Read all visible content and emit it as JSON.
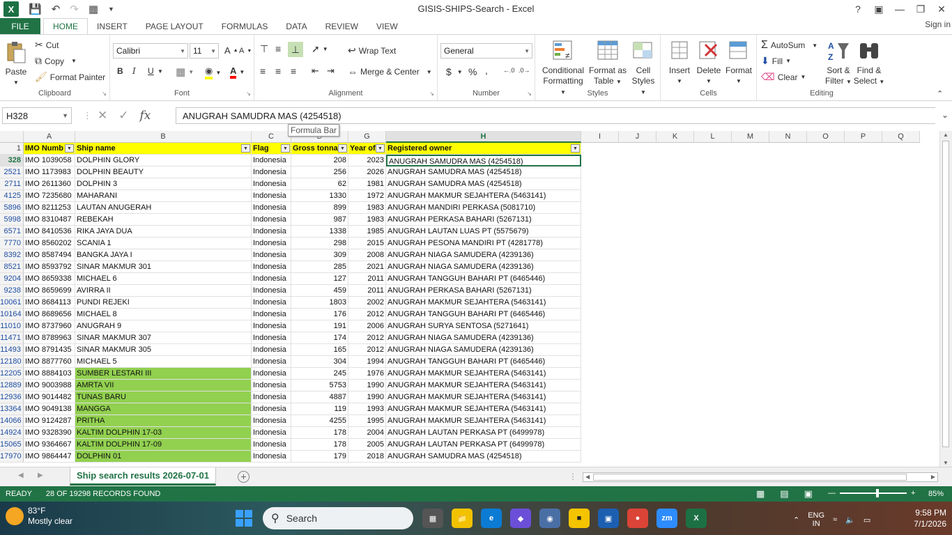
{
  "window": {
    "title": "GISIS-SHIPS-Search - Excel",
    "help": "?",
    "signin": "Sign in"
  },
  "tabs": [
    "FILE",
    "HOME",
    "INSERT",
    "PAGE LAYOUT",
    "FORMULAS",
    "DATA",
    "REVIEW",
    "VIEW"
  ],
  "ribbon": {
    "clipboard": {
      "paste": "Paste",
      "cut": "Cut",
      "copy": "Copy",
      "format_painter": "Format Painter",
      "label": "Clipboard"
    },
    "font": {
      "name": "Calibri",
      "size": "11",
      "bold": "B",
      "italic": "I",
      "underline": "U",
      "label": "Font"
    },
    "alignment": {
      "wrap": "Wrap Text",
      "merge": "Merge & Center",
      "label": "Alignment"
    },
    "number": {
      "format": "General",
      "currency": "$",
      "percent": "%",
      "comma": ",",
      "label": "Number"
    },
    "styles": {
      "conditional": "Conditional",
      "conditional2": "Formatting",
      "format_as": "Format as",
      "format_as2": "Table",
      "cell": "Cell",
      "cell2": "Styles",
      "label": "Styles"
    },
    "cells": {
      "insert": "Insert",
      "delete": "Delete",
      "format": "Format",
      "label": "Cells"
    },
    "editing": {
      "autosum": "AutoSum",
      "fill": "Fill",
      "clear": "Clear",
      "sort": "Sort &",
      "sort2": "Filter",
      "find": "Find &",
      "find2": "Select",
      "label": "Editing"
    }
  },
  "formula_bar": {
    "name_box": "H328",
    "value": "ANUGRAH SAMUDRA MAS (4254518)",
    "tooltip": "Formula Bar",
    "fx": "fx"
  },
  "columns": [
    "A",
    "B",
    "C",
    "D",
    "G",
    "H",
    "I",
    "J",
    "K",
    "L",
    "M",
    "N",
    "O",
    "P",
    "Q"
  ],
  "header_row": {
    "num": "1",
    "a": "IMO Numb",
    "b": "Ship name",
    "c": "Flag",
    "d": "Gross tonnag",
    "g": "Year of",
    "h": "Registered owner"
  },
  "rows": [
    {
      "n": "328",
      "imo": "IMO 1039058",
      "ship": "DOLPHIN GLORY",
      "flag": "Indonesia",
      "gt": "208",
      "year": "2023",
      "owner": "ANUGRAH SAMUDRA MAS (4254518)",
      "green": false
    },
    {
      "n": "2521",
      "imo": "IMO 1173983",
      "ship": "DOLPHIN BEAUTY",
      "flag": "Indonesia",
      "gt": "256",
      "year": "2026",
      "owner": "ANUGRAH SAMUDRA MAS (4254518)",
      "green": false
    },
    {
      "n": "2711",
      "imo": "IMO 2611360",
      "ship": "DOLPHIN 3",
      "flag": "Indonesia",
      "gt": "62",
      "year": "1981",
      "owner": "ANUGRAH SAMUDRA MAS (4254518)",
      "green": false
    },
    {
      "n": "4125",
      "imo": "IMO 7235680",
      "ship": "MAHARANI",
      "flag": "Indonesia",
      "gt": "1330",
      "year": "1972",
      "owner": "ANUGRAH MAKMUR SEJAHTERA (5463141)",
      "green": false
    },
    {
      "n": "5896",
      "imo": "IMO 8211253",
      "ship": "LAUTAN ANUGERAH",
      "flag": "Indonesia",
      "gt": "899",
      "year": "1983",
      "owner": "ANUGRAH MANDIRI PERKASA (5081710)",
      "green": false
    },
    {
      "n": "5998",
      "imo": "IMO 8310487",
      "ship": "REBEKAH",
      "flag": "Indonesia",
      "gt": "987",
      "year": "1983",
      "owner": "ANUGRAH PERKASA BAHARI (5267131)",
      "green": false
    },
    {
      "n": "6571",
      "imo": "IMO 8410536",
      "ship": "RIKA JAYA DUA",
      "flag": "Indonesia",
      "gt": "1338",
      "year": "1985",
      "owner": "ANUGRAH LAUTAN LUAS PT (5575679)",
      "green": false
    },
    {
      "n": "7770",
      "imo": "IMO 8560202",
      "ship": "SCANIA 1",
      "flag": "Indonesia",
      "gt": "298",
      "year": "2015",
      "owner": "ANUGRAH PESONA MANDIRI PT (4281778)",
      "green": false
    },
    {
      "n": "8392",
      "imo": "IMO 8587494",
      "ship": "BANGKA JAYA I",
      "flag": "Indonesia",
      "gt": "309",
      "year": "2008",
      "owner": "ANUGRAH NIAGA SAMUDERA (4239136)",
      "green": false
    },
    {
      "n": "8521",
      "imo": "IMO 8593792",
      "ship": "SINAR MAKMUR 301",
      "flag": "Indonesia",
      "gt": "285",
      "year": "2021",
      "owner": "ANUGRAH NIAGA SAMUDERA (4239136)",
      "green": false
    },
    {
      "n": "9204",
      "imo": "IMO 8659338",
      "ship": "MICHAEL 6",
      "flag": "Indonesia",
      "gt": "127",
      "year": "2011",
      "owner": "ANUGRAH TANGGUH BAHARI PT (6465446)",
      "green": false
    },
    {
      "n": "9238",
      "imo": "IMO 8659699",
      "ship": "AVIRRA II",
      "flag": "Indonesia",
      "gt": "459",
      "year": "2011",
      "owner": "ANUGRAH PERKASA BAHARI (5267131)",
      "green": false
    },
    {
      "n": "10061",
      "imo": "IMO 8684113",
      "ship": "PUNDI REJEKI",
      "flag": "Indonesia",
      "gt": "1803",
      "year": "2002",
      "owner": "ANUGRAH MAKMUR SEJAHTERA (5463141)",
      "green": false
    },
    {
      "n": "10164",
      "imo": "IMO 8689656",
      "ship": "MICHAEL 8",
      "flag": "Indonesia",
      "gt": "176",
      "year": "2012",
      "owner": "ANUGRAH TANGGUH BAHARI PT (6465446)",
      "green": false
    },
    {
      "n": "11010",
      "imo": "IMO 8737960",
      "ship": "ANUGRAH 9",
      "flag": "Indonesia",
      "gt": "191",
      "year": "2006",
      "owner": "ANUGRAH SURYA SENTOSA (5271641)",
      "green": false
    },
    {
      "n": "11471",
      "imo": "IMO 8789963",
      "ship": "SINAR MAKMUR 307",
      "flag": "Indonesia",
      "gt": "174",
      "year": "2012",
      "owner": "ANUGRAH NIAGA SAMUDERA (4239136)",
      "green": false
    },
    {
      "n": "11493",
      "imo": "IMO 8791435",
      "ship": "SINAR MAKMUR 305",
      "flag": "Indonesia",
      "gt": "165",
      "year": "2012",
      "owner": "ANUGRAH NIAGA SAMUDERA (4239136)",
      "green": false
    },
    {
      "n": "12180",
      "imo": "IMO 8877760",
      "ship": "MICHAEL 5",
      "flag": "Indonesia",
      "gt": "304",
      "year": "1994",
      "owner": "ANUGRAH TANGGUH BAHARI PT (6465446)",
      "green": false
    },
    {
      "n": "12205",
      "imo": "IMO 8884103",
      "ship": "SUMBER LESTARI III",
      "flag": "Indonesia",
      "gt": "245",
      "year": "1976",
      "owner": "ANUGRAH MAKMUR SEJAHTERA (5463141)",
      "green": true
    },
    {
      "n": "12889",
      "imo": "IMO 9003988",
      "ship": "AMRTA VII",
      "flag": "Indonesia",
      "gt": "5753",
      "year": "1990",
      "owner": "ANUGRAH MAKMUR SEJAHTERA (5463141)",
      "green": true
    },
    {
      "n": "12936",
      "imo": "IMO 9014482",
      "ship": "TUNAS BARU",
      "flag": "Indonesia",
      "gt": "4887",
      "year": "1990",
      "owner": "ANUGRAH MAKMUR SEJAHTERA (5463141)",
      "green": true
    },
    {
      "n": "13364",
      "imo": "IMO 9049138",
      "ship": "MANGGA",
      "flag": "Indonesia",
      "gt": "119",
      "year": "1993",
      "owner": "ANUGRAH MAKMUR SEJAHTERA (5463141)",
      "green": true
    },
    {
      "n": "14066",
      "imo": "IMO 9124287",
      "ship": "PRITHA",
      "flag": "Indonesia",
      "gt": "4255",
      "year": "1995",
      "owner": "ANUGRAH MAKMUR SEJAHTERA (5463141)",
      "green": true
    },
    {
      "n": "14924",
      "imo": "IMO 9328390",
      "ship": "KALTIM DOLPHIN 17-03",
      "flag": "Indonesia",
      "gt": "178",
      "year": "2004",
      "owner": "ANUGRAH LAUTAN PERKASA PT (6499978)",
      "green": true
    },
    {
      "n": "15065",
      "imo": "IMO 9364667",
      "ship": "KALTIM DOLPHIN 17-09",
      "flag": "Indonesia",
      "gt": "178",
      "year": "2005",
      "owner": "ANUGRAH LAUTAN PERKASA PT (6499978)",
      "green": true
    },
    {
      "n": "17970",
      "imo": "IMO 9864447",
      "ship": "DOLPHIN 01",
      "flag": "Indonesia",
      "gt": "179",
      "year": "2018",
      "owner": "ANUGRAH SAMUDRA MAS (4254518)",
      "green": true
    }
  ],
  "sheet_tab": "Ship search results 2026-07-01",
  "status": {
    "mode": "READY",
    "records": "28 OF 19298 RECORDS FOUND",
    "zoom": "85%"
  },
  "taskbar": {
    "temp": "83°F",
    "weather": "Mostly clear",
    "search": "Search",
    "lang": "ENG",
    "lang2": "IN",
    "time": "9:58 PM",
    "date": "7/1/2026"
  },
  "colors": {
    "excel_green": "#217346",
    "header_yellow": "#ffff00",
    "highlight_green": "#92d050"
  }
}
